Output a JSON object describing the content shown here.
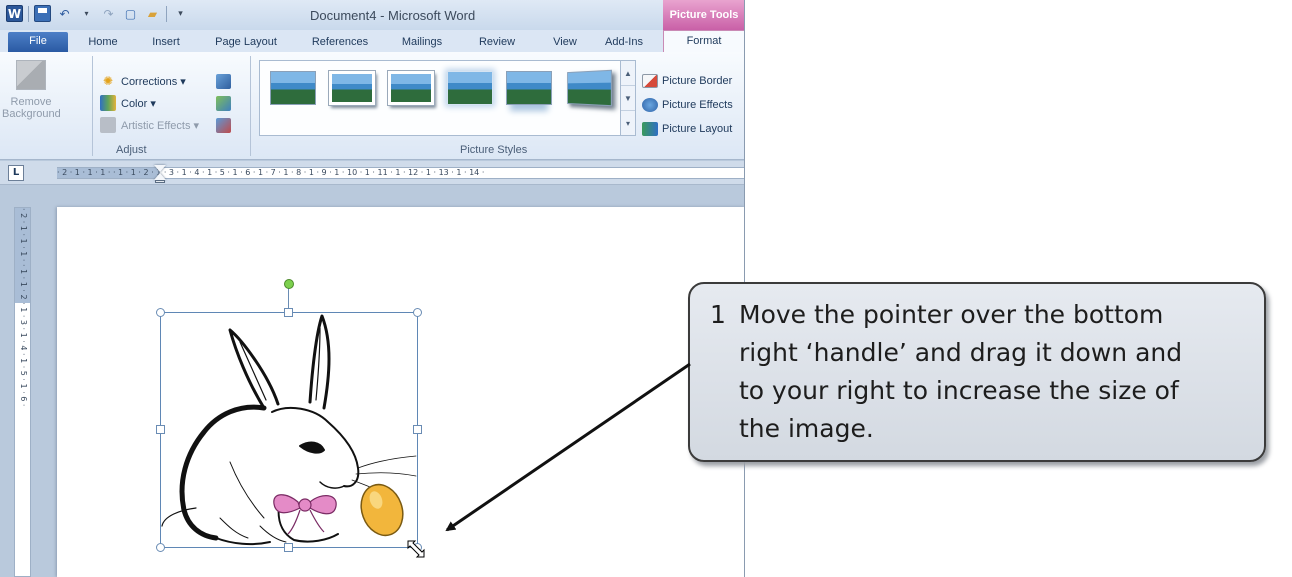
{
  "window": {
    "title": "Document4 - Microsoft Word",
    "context_tab": "Picture Tools"
  },
  "tabs": {
    "file": "File",
    "home": "Home",
    "insert": "Insert",
    "page_layout": "Page Layout",
    "references": "References",
    "mailings": "Mailings",
    "review": "Review",
    "view": "View",
    "addins": "Add-Ins",
    "format": "Format"
  },
  "ribbon": {
    "adjust": {
      "remove_background_line1": "Remove",
      "remove_background_line2": "Background",
      "corrections": "Corrections ▾",
      "color": "Color ▾",
      "artistic_effects": "Artistic Effects ▾",
      "group_label": "Adjust"
    },
    "picture_styles": {
      "group_label": "Picture Styles",
      "picture_border": "Picture Border",
      "picture_effects": "Picture Effects",
      "picture_layout": "Picture Layout"
    }
  },
  "ruler": {
    "tab_selector": "L",
    "labels": "· 2 · 1 · 1 · 1 ·       · 1 · 1 · 2 · 1 · 3 · 1 · 4 · 1 · 5 · 1 · 6 · 1 · 7 · 1 · 8 · 1 · 9 · 1 · 10 · 1 · 11 · 1 · 12 · 1 · 13 · 1 · 14 ·",
    "vertical_labels": "· 2 · 1 · 1 · 1 ·   · 1 · 1 · 2 · 1 · 3 · 1 · 4 · 1 · 5 · 1 · 6 ·"
  },
  "callout": {
    "number": "1",
    "lines": [
      "Move the pointer over the bottom",
      "right ‘handle’ and drag it down and",
      "to your right to increase the size of",
      "the image."
    ]
  },
  "colors": {
    "accent": "#2b579a",
    "context_tab": "#c960a7",
    "selection": "#5f87b5",
    "rotation_handle": "#7dd04e",
    "egg": "#f2b63c",
    "bow": "#e48bc7"
  }
}
